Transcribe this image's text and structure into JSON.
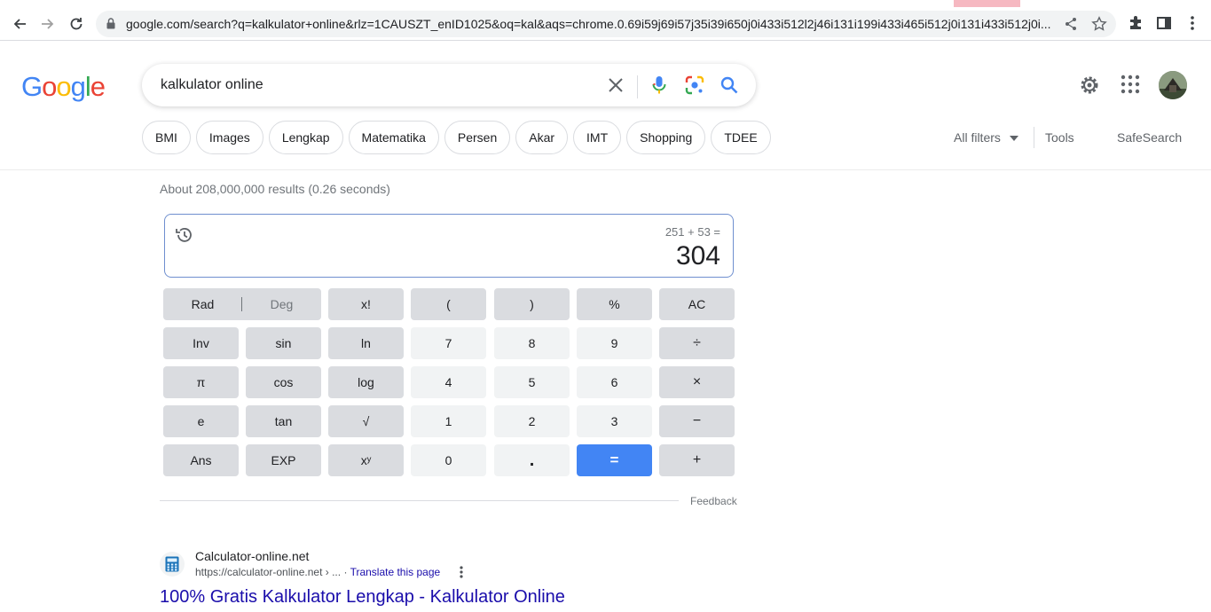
{
  "browser": {
    "url": "google.com/search?q=kalkulator+online&rlz=1CAUSZT_enID1025&oq=kal&aqs=chrome.0.69i59j69i57j35i39i650j0i433i512l2j46i131i199i433i465i512j0i131i433i512j0i...",
    "colors": {
      "tabstrip": "#f6b8c1"
    }
  },
  "google": {
    "logo": [
      "G",
      "o",
      "o",
      "g",
      "l",
      "e"
    ],
    "logo_colors": [
      "#4285f4",
      "#ea4335",
      "#fbbc05",
      "#4285f4",
      "#34a853",
      "#ea4335"
    ],
    "query": "kalkulator online",
    "chips": [
      "BMI",
      "Images",
      "Lengkap",
      "Matematika",
      "Persen",
      "Akar",
      "IMT",
      "Shopping",
      "TDEE"
    ],
    "all_filters": "All filters",
    "tools": "Tools",
    "safesearch": "SafeSearch",
    "stats": "About 208,000,000 results (0.26 seconds)"
  },
  "calculator": {
    "expression": "251 + 53 =",
    "result": "304",
    "rad": "Rad",
    "deg": "Deg",
    "keys": {
      "fact": "x!",
      "lparen": "(",
      "rparen": ")",
      "percent": "%",
      "ac": "AC",
      "inv": "Inv",
      "sin": "sin",
      "ln": "ln",
      "k7": "7",
      "k8": "8",
      "k9": "9",
      "div": "÷",
      "pi": "π",
      "cos": "cos",
      "log": "log",
      "k4": "4",
      "k5": "5",
      "k6": "6",
      "mul": "×",
      "e": "e",
      "tan": "tan",
      "sqrt": "√",
      "k1": "1",
      "k2": "2",
      "k3": "3",
      "minus": "−",
      "ans": "Ans",
      "exp": "EXP",
      "pow": "xʸ",
      "k0": "0",
      "dot": ".",
      "eq": "=",
      "plus": "+"
    },
    "feedback": "Feedback",
    "colors": {
      "equals": "#4285f4",
      "display_border": "#6f8fcf"
    }
  },
  "result": {
    "site_name": "Calculator-online.net",
    "url": "https://calculator-online.net › ...",
    "translate": "Translate this page",
    "title": "100% Gratis Kalkulator Lengkap - Kalkulator Online",
    "colors": {
      "link": "#1a0dab"
    }
  }
}
